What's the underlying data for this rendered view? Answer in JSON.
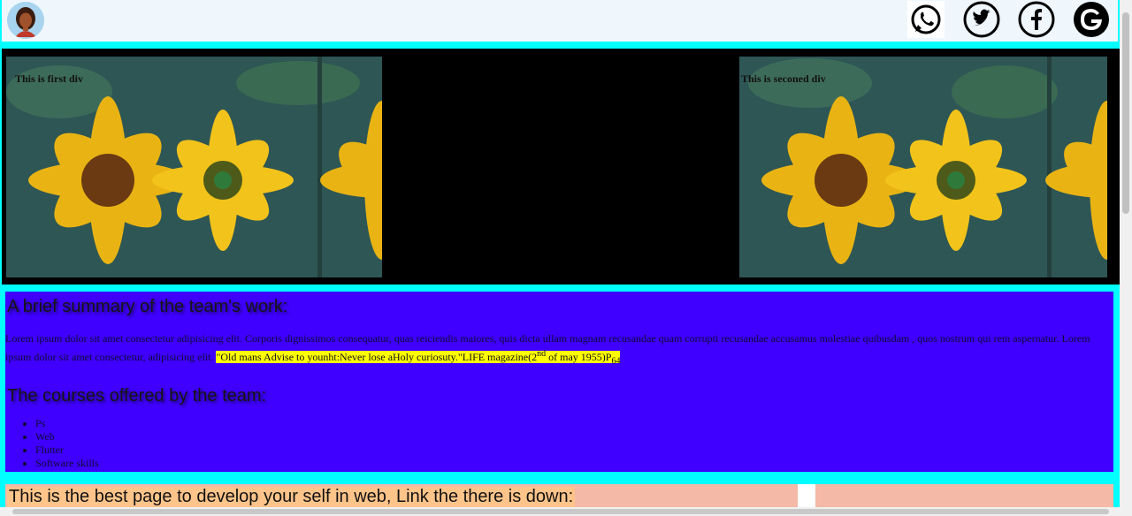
{
  "header": {
    "avatar_icon": "user-avatar-icon",
    "social": [
      {
        "name": "whatsapp",
        "icon": "whatsapp-icon"
      },
      {
        "name": "twitter",
        "icon": "twitter-icon"
      },
      {
        "name": "facebook",
        "icon": "facebook-icon"
      },
      {
        "name": "google",
        "icon": "google-icon"
      }
    ]
  },
  "banner": {
    "first_caption": "This is first div",
    "second_caption": "This is seconed div",
    "image_icon": "sunflower-image"
  },
  "summary": {
    "title": "A brief summary of the team's work:",
    "paragraph": "Lorem ipsum dolor sit amet consectetur adipisicing elit. Corporis dignissimos consequatur, quas reiciendis maiores, quis dicta ullam magnam recusandae quam corrupti recusandae accusamus molestiae quibusdam , quos nostrum qui rem aspernatur. Lorem ipsum dolor sit amet consectetur, adipisicing elit.",
    "quote_main": "\"Old mans Advise to younht:Never lose aHoly curiosuty.\"LIFE magazine(2",
    "quote_sup": "nd",
    "quote_tail": " of may 1955)P",
    "quote_sub": "64",
    "courses_title": "The courses offered by the team:",
    "courses": [
      "Ps",
      "Web",
      "Flutter",
      "Software skills"
    ]
  },
  "bottom": {
    "text": "This is the best page to develop your self in web, Link the there is down:"
  },
  "colors": {
    "page_bg": "#00ffff",
    "header_bg": "#eff7fd",
    "banner_bg": "#000000",
    "summary_bg": "#3f00ff",
    "highlight": "#ffff00",
    "bottom_bg": "#f4b9a7"
  }
}
